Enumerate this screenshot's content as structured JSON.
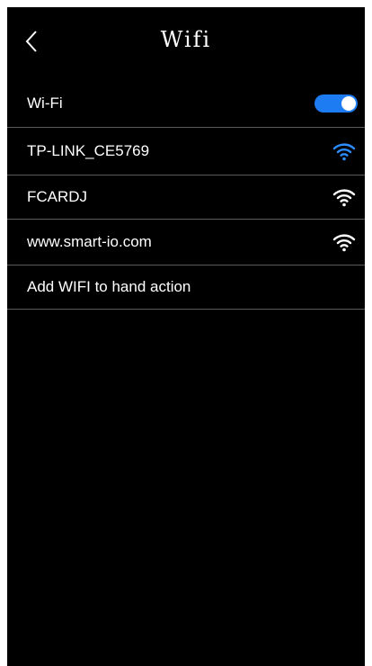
{
  "header": {
    "title": "Wifi",
    "back_icon": "chevron-left-icon"
  },
  "wifi_toggle": {
    "label": "Wi-Fi",
    "enabled": true,
    "accent_color": "#1e7cf2"
  },
  "networks": [
    {
      "ssid": "TP-LINK_CE5769",
      "signal_color": "#2d8cff",
      "icon": "wifi-icon"
    },
    {
      "ssid": "FCARDJ",
      "signal_color": "#ffffff",
      "icon": "wifi-icon"
    },
    {
      "ssid": "www.smart-io.com",
      "signal_color": "#ffffff",
      "icon": "wifi-icon"
    }
  ],
  "add_network": {
    "label": "Add WIFI to hand action"
  }
}
